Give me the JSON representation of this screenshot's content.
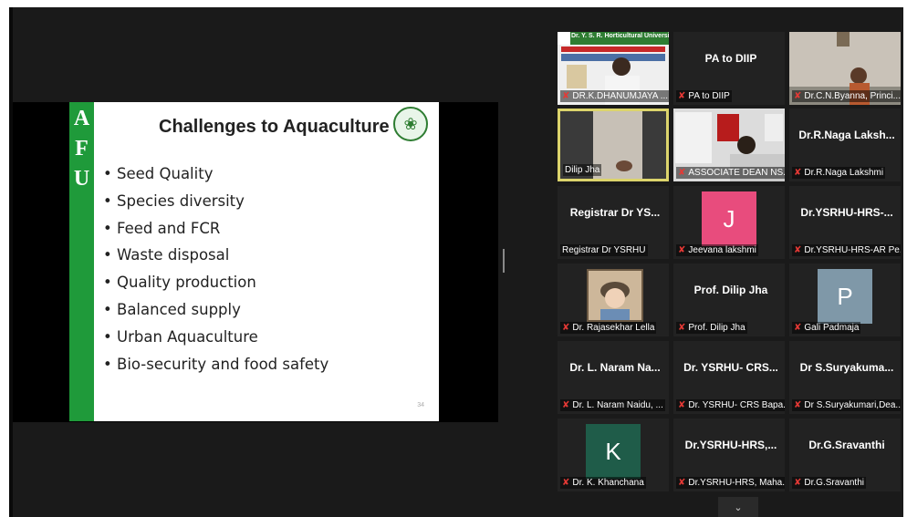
{
  "slide": {
    "side_letters": [
      "A",
      "F",
      "U"
    ],
    "title": "Challenges to Aquaculture",
    "bullets": [
      "Seed Quality",
      "Species diversity",
      "Feed and FCR",
      "Waste disposal",
      "Quality production",
      "Balanced supply",
      "Urban Aquaculture",
      "Bio-security and food safety"
    ],
    "page_number": "34",
    "accent_color": "#1f9a3a"
  },
  "participants": [
    {
      "label": "DR.K.DHANUMJAYA ...",
      "name": "",
      "muted": true,
      "kind": "video-banner",
      "banner": "Dr. Y. S. R. Horticultural University"
    },
    {
      "label": "PA to DIIP",
      "name": "PA to DIIP",
      "muted": true,
      "kind": "name"
    },
    {
      "label": "Dr.C.N.Byanna, Princi...",
      "name": "",
      "muted": true,
      "kind": "video-office"
    },
    {
      "label": "Dilip Jha",
      "name": "",
      "muted": false,
      "kind": "video-wall",
      "active": true
    },
    {
      "label": "ASSOCIATE DEAN NS...",
      "name": "",
      "muted": true,
      "kind": "video-desk"
    },
    {
      "label": "Dr.R.Naga Lakshmi",
      "name": "Dr.R.Naga Laksh...",
      "muted": true,
      "kind": "name"
    },
    {
      "label": "Registrar Dr YSRHU",
      "name": "Registrar Dr YS...",
      "muted": false,
      "kind": "name"
    },
    {
      "label": "Jeevana lakshmi",
      "name": "J",
      "muted": true,
      "kind": "avatar",
      "color": "#e84c7d"
    },
    {
      "label": "Dr.YSRHU-HRS-AR Pe...",
      "name": "Dr.YSRHU-HRS-...",
      "muted": true,
      "kind": "name"
    },
    {
      "label": "Dr. Rajasekhar Lella",
      "name": "",
      "muted": true,
      "kind": "photo"
    },
    {
      "label": "Prof. Dilip Jha",
      "name": "Prof. Dilip Jha",
      "muted": true,
      "kind": "name"
    },
    {
      "label": "Gali Padmaja",
      "name": "P",
      "muted": true,
      "kind": "avatar",
      "color": "#7f98a8"
    },
    {
      "label": "Dr. L. Naram Naidu, ...",
      "name": "Dr. L. Naram Na...",
      "muted": true,
      "kind": "name"
    },
    {
      "label": "Dr. YSRHU- CRS Bapa...",
      "name": "Dr. YSRHU- CRS...",
      "muted": true,
      "kind": "name"
    },
    {
      "label": "Dr S.Suryakumari,Dea...",
      "name": "Dr S.Suryakuma...",
      "muted": true,
      "kind": "name"
    },
    {
      "label": "Dr. K. Khanchana",
      "name": "K",
      "muted": true,
      "kind": "avatar",
      "color": "#1f5c49"
    },
    {
      "label": "Dr.YSRHU-HRS, Maha...",
      "name": "Dr.YSRHU-HRS,...",
      "muted": true,
      "kind": "name"
    },
    {
      "label": "Dr.G.Sravanthi",
      "name": "Dr.G.Sravanthi",
      "muted": true,
      "kind": "name"
    }
  ],
  "icons": {
    "muted_mic": "mic-off-icon",
    "more": "chevron-down-icon"
  }
}
